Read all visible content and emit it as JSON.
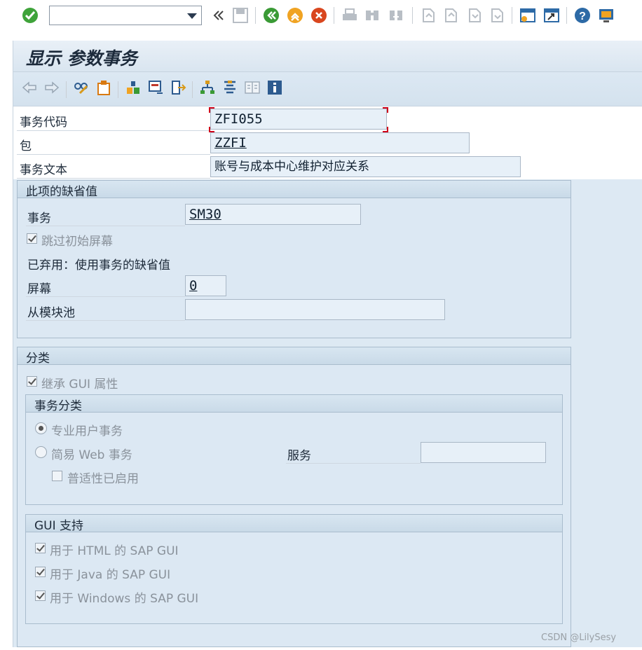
{
  "toolbar": {
    "command_field_value": "",
    "icons": [
      "enter-icon",
      "back-icon",
      "exit-icon",
      "cancel-icon",
      "print-icon",
      "find-icon",
      "find-next-icon",
      "first-page-icon",
      "previous-page-icon",
      "next-page-icon",
      "last-page-icon",
      "new-session-icon",
      "shortcut-icon",
      "help-icon",
      "customize-layout-icon"
    ]
  },
  "screen": {
    "title": "显示 参数事务"
  },
  "header": {
    "tcode_label": "事务代码",
    "tcode_value": "ZFI055",
    "package_label": "包",
    "package_value": "ZZFI",
    "text_label": "事务文本",
    "text_value": "账号与成本中心维护对应关系"
  },
  "defaults": {
    "title": "此项的缺省值",
    "transaction_label": "事务",
    "transaction_value": "SM30",
    "skip_screen_label": "跳过初始屏幕",
    "skip_screen_checked": true,
    "obsolete_label": "已弃用：使用事务的缺省值",
    "screen_label": "屏幕",
    "screen_value": "0",
    "module_pool_label": "从模块池",
    "module_pool_value": ""
  },
  "classification": {
    "title": "分类",
    "inherit_gui_label": "继承 GUI 属性",
    "inherit_gui_checked": true,
    "tx_class_title": "事务分类",
    "pro_user_label": "专业用户事务",
    "pro_user_selected": true,
    "easy_web_label": "简易 Web 事务",
    "service_label": "服务",
    "service_value": "",
    "pervasive_label": "普适性已启用",
    "gui_support_title": "GUI 支持",
    "html_gui_label": "用于 HTML 的 SAP GUI",
    "java_gui_label": "用于 Java 的 SAP GUI",
    "windows_gui_label": "用于 Windows 的 SAP GUI"
  },
  "watermark": "CSDN @LilySesy",
  "colors": {
    "frame_bg": "#dde9f3",
    "field_bg": "#e7f0f8",
    "focus_corner": "#d0021b"
  }
}
